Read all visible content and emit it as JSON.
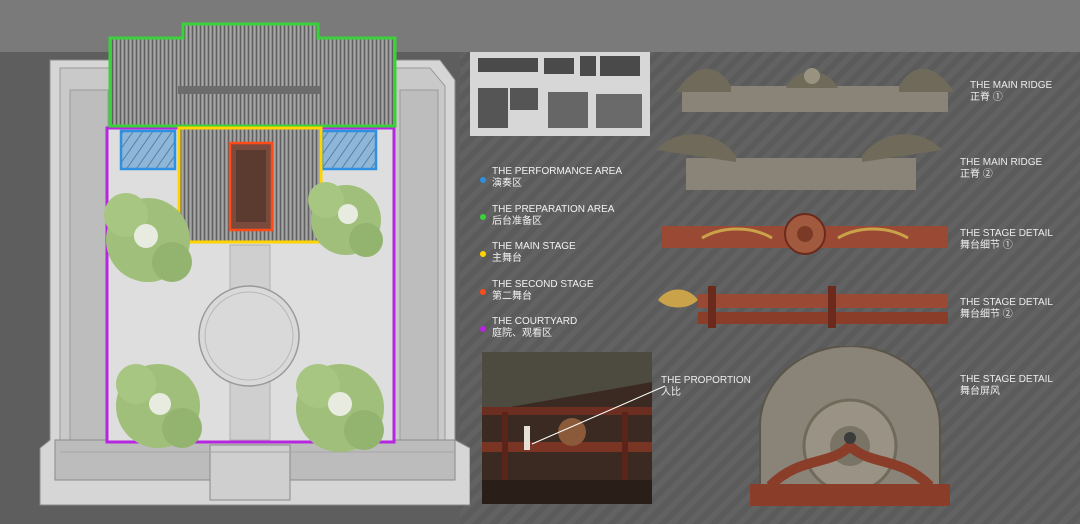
{
  "legend": [
    {
      "en": "THE PERFORMANCE AREA",
      "zh": "演奏区",
      "color": "#2f8fe0"
    },
    {
      "en": "THE PREPARATION AREA",
      "zh": "后台准备区",
      "color": "#3ad13a"
    },
    {
      "en": "THE MAIN STAGE",
      "zh": "主舞台",
      "color": "#ffd400"
    },
    {
      "en": "THE SECOND STAGE",
      "zh": "第二舞台",
      "color": "#ff4a1a"
    },
    {
      "en": "THE COURTYARD",
      "zh": "庭院、观看区",
      "color": "#b626e0"
    }
  ],
  "proportion": {
    "en": "THE PROPORTION",
    "zh": "人比"
  },
  "details": [
    {
      "en": "THE MAIN RIDGE",
      "zh": "正脊 ①"
    },
    {
      "en": "THE MAIN RIDGE",
      "zh": "正脊 ②"
    },
    {
      "en": "THE STAGE DETAIL",
      "zh": "舞台细节 ①"
    },
    {
      "en": "THE STAGE DETAIL",
      "zh": "舞台细节 ②"
    },
    {
      "en": "THE STAGE DETAIL",
      "zh": "舞台屏风"
    }
  ]
}
